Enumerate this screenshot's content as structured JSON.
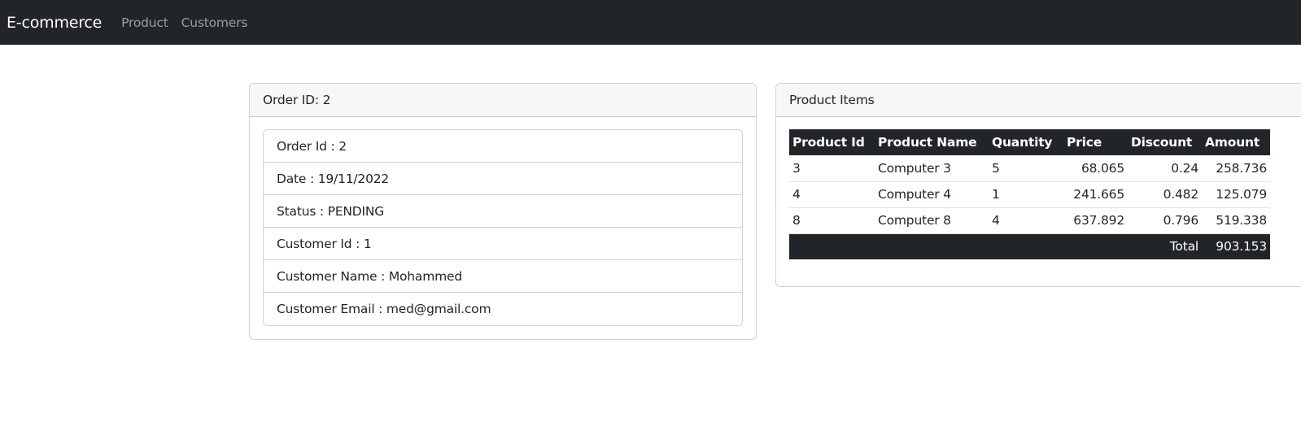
{
  "navbar": {
    "brand": "E-commerce",
    "links": [
      "Product",
      "Customers"
    ]
  },
  "order_card": {
    "header": "Order ID: 2",
    "items": [
      "Order Id : 2",
      "Date : 19/11/2022",
      "Status : PENDING",
      "Customer Id : 1",
      "Customer Name : Mohammed",
      "Customer Email : med@gmail.com"
    ]
  },
  "items_card": {
    "header": "Product Items",
    "columns": [
      "Product Id",
      "Product Name",
      "Quantity",
      "Price",
      "Discount",
      "Amount"
    ],
    "rows": [
      [
        "3",
        "Computer 3",
        "5",
        "68.065",
        "0.24",
        "258.736"
      ],
      [
        "4",
        "Computer 4",
        "1",
        "241.665",
        "0.482",
        "125.079"
      ],
      [
        "8",
        "Computer 8",
        "4",
        "637.892",
        "0.796",
        "519.338"
      ]
    ],
    "total_label": "Total",
    "total_value": "903.153"
  }
}
